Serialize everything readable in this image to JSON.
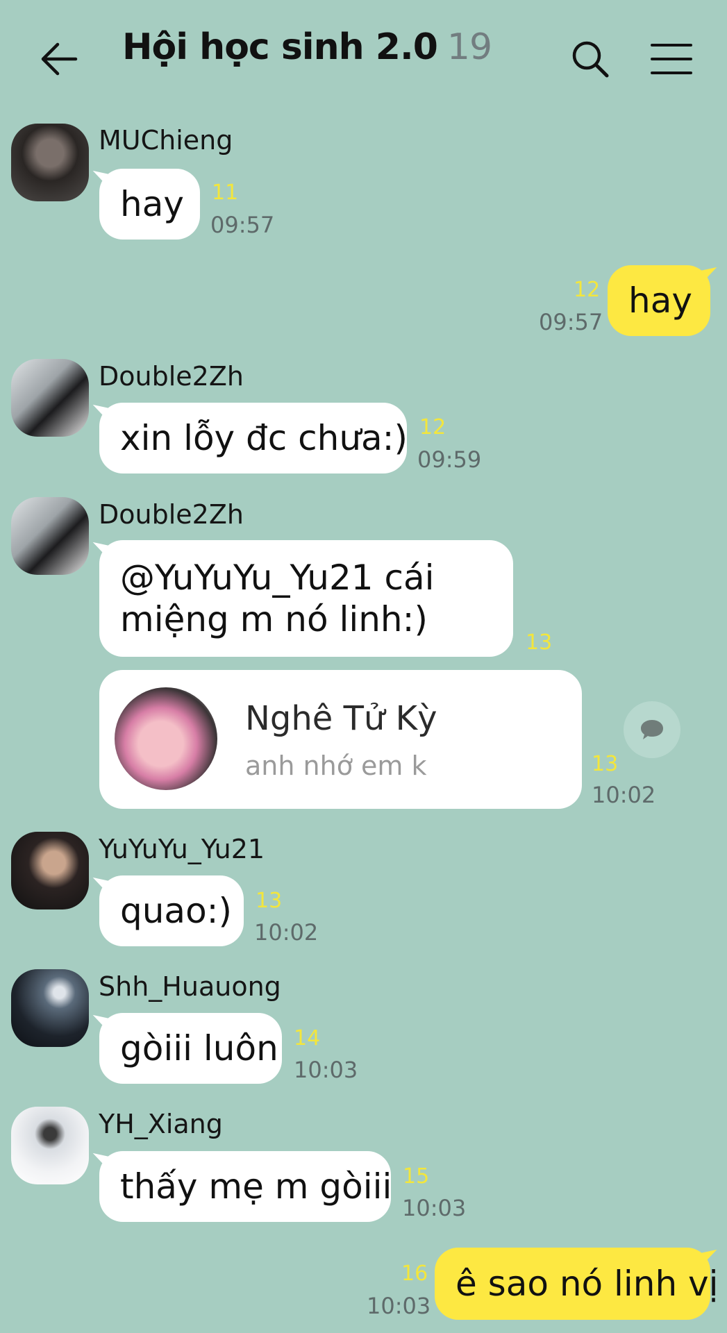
{
  "header": {
    "title": "Hội học sinh 2.0",
    "member_count": "19"
  },
  "messages": [
    {
      "name": "MUChieng",
      "text": "hay",
      "unread": "11",
      "time": "09:57"
    },
    {
      "text": "hay",
      "unread": "12",
      "time": "09:57"
    },
    {
      "name": "Double2Zh",
      "text": "xin lỗy đc chưa:)",
      "unread": "12",
      "time": "09:59"
    },
    {
      "name": "Double2Zh",
      "line1": "@YuYuYu_Yu21 cái",
      "line2": "miệng m nó linh:)",
      "unread": "13"
    },
    {
      "card_name": "Nghê Tử Kỳ",
      "card_sub": "anh nhớ em k",
      "unread": "13",
      "time": "10:02"
    },
    {
      "name": "YuYuYu_Yu21",
      "text": "quao:)",
      "unread": "13",
      "time": "10:02"
    },
    {
      "name": "Shh_Huauong",
      "text": "gòiii luôn",
      "unread": "14",
      "time": "10:03"
    },
    {
      "name": "YH_Xiang",
      "text": "thấy mẹ m gòiii",
      "unread": "15",
      "time": "10:03"
    },
    {
      "text": "ê sao nó linh vị",
      "unread": "16",
      "time": "10:03"
    }
  ],
  "colors": {
    "background": "#a6cdc1",
    "outgoing_bubble": "#fde842",
    "incoming_bubble": "#ffffff",
    "unread": "#f3e63c"
  },
  "icons": [
    "back-arrow-icon",
    "search-icon",
    "menu-icon",
    "reply-bubble-icon"
  ]
}
